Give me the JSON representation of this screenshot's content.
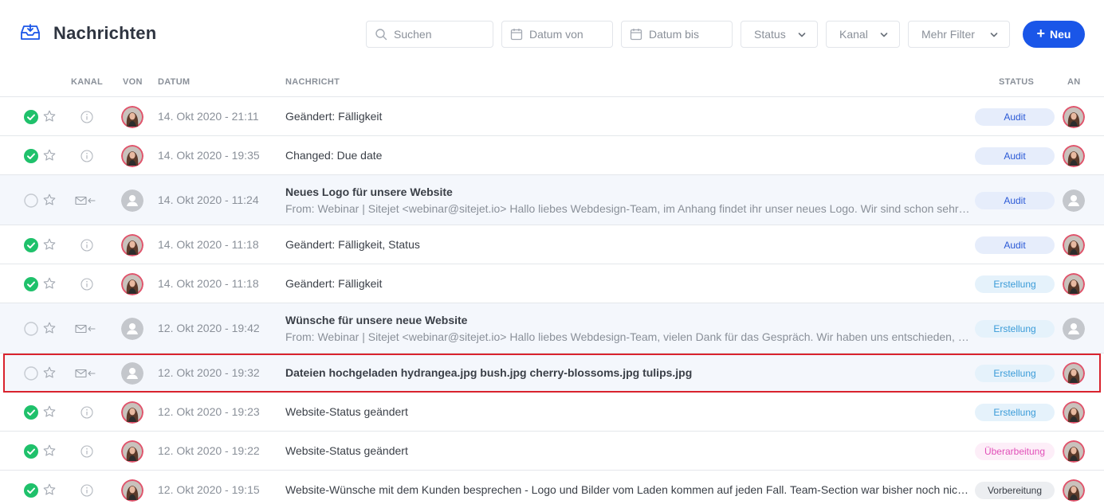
{
  "header": {
    "title": "Nachrichten",
    "search_placeholder": "Suchen",
    "date_from_placeholder": "Datum von",
    "date_to_placeholder": "Datum bis",
    "status_filter": "Status",
    "kanal_filter": "Kanal",
    "more_filter": "Mehr Filter",
    "new_button": "Neu"
  },
  "columns": {
    "kanal": "KANAL",
    "von": "VON",
    "datum": "DATUM",
    "nachricht": "NACHRICHT",
    "status": "STATUS",
    "an": "AN"
  },
  "colors": {
    "accent": "#1a56e8",
    "done": "#1fc16b",
    "selection": "#d9232e"
  },
  "rows": [
    {
      "done": true,
      "channel_icon": "info-icon",
      "from_avatar": "photo",
      "date": "14. Okt 2020 - 21:11",
      "subject": "Geändert: Fälligkeit",
      "preview": "",
      "bold": false,
      "status": "Audit",
      "status_class": "audit",
      "to_avatar": "photo"
    },
    {
      "done": true,
      "channel_icon": "info-icon",
      "from_avatar": "photo",
      "date": "14. Okt 2020 - 19:35",
      "subject": "Changed: Due date",
      "preview": "",
      "bold": false,
      "status": "Audit",
      "status_class": "audit",
      "to_avatar": "photo"
    },
    {
      "done": false,
      "channel_icon": "mail-in-icon",
      "from_avatar": "placeholder",
      "date": "14. Okt 2020 - 11:24",
      "subject": "Neues Logo für unsere Website",
      "preview": "From: Webinar | Sitejet <webinar@sitejet.io> Hallo liebes Webdesign-Team,   im Anhang findet ihr unser neues Logo.   Wir sind schon sehr ge...",
      "bold": true,
      "status": "Audit",
      "status_class": "audit",
      "to_avatar": "placeholder"
    },
    {
      "done": true,
      "channel_icon": "info-icon",
      "from_avatar": "photo",
      "date": "14. Okt 2020 - 11:18",
      "subject": "Geändert: Fälligkeit, Status",
      "preview": "",
      "bold": false,
      "status": "Audit",
      "status_class": "audit",
      "to_avatar": "photo"
    },
    {
      "done": true,
      "channel_icon": "info-icon",
      "from_avatar": "photo",
      "date": "14. Okt 2020 - 11:18",
      "subject": "Geändert: Fälligkeit",
      "preview": "",
      "bold": false,
      "status": "Erstellung",
      "status_class": "erstellung",
      "to_avatar": "photo"
    },
    {
      "done": false,
      "channel_icon": "mail-in-icon",
      "from_avatar": "placeholder",
      "date": "12. Okt 2020 - 19:42",
      "subject": "Wünsche für unsere neue Website",
      "preview": "From: Webinar | Sitejet <webinar@sitejet.io> Hallo liebes Webdesign-Team,   vielen Dank für das Gespräch. Wir haben uns entschieden, dass ...",
      "bold": true,
      "status": "Erstellung",
      "status_class": "erstellung",
      "to_avatar": "placeholder"
    },
    {
      "done": false,
      "channel_icon": "mail-in-icon",
      "from_avatar": "placeholder",
      "date": "12. Okt 2020 - 19:32",
      "subject": "Dateien hochgeladen hydrangea.jpg bush.jpg cherry-blossoms.jpg tulips.jpg",
      "preview": "",
      "bold": true,
      "status": "Erstellung",
      "status_class": "erstellung",
      "to_avatar": "photo",
      "selected": true
    },
    {
      "done": true,
      "channel_icon": "info-icon",
      "from_avatar": "photo",
      "date": "12. Okt 2020 - 19:23",
      "subject": "Website-Status geändert",
      "preview": "",
      "bold": false,
      "status": "Erstellung",
      "status_class": "erstellung",
      "to_avatar": "photo"
    },
    {
      "done": true,
      "channel_icon": "info-icon",
      "from_avatar": "photo",
      "date": "12. Okt 2020 - 19:22",
      "subject": "Website-Status geändert",
      "preview": "",
      "bold": false,
      "status": "Überarbeitung",
      "status_class": "ueberarbeitung",
      "to_avatar": "photo"
    },
    {
      "done": true,
      "channel_icon": "info-icon",
      "from_avatar": "photo",
      "date": "12. Okt 2020 - 19:15",
      "subject": "Website-Wünsche mit dem Kunden besprechen - Logo und Bilder vom Laden kommen auf jeden Fall. Team-Section war bisher noch nicht sic...",
      "preview": "",
      "bold": false,
      "status": "Vorbereitung",
      "status_class": "vorbereitung",
      "to_avatar": "photo"
    }
  ]
}
